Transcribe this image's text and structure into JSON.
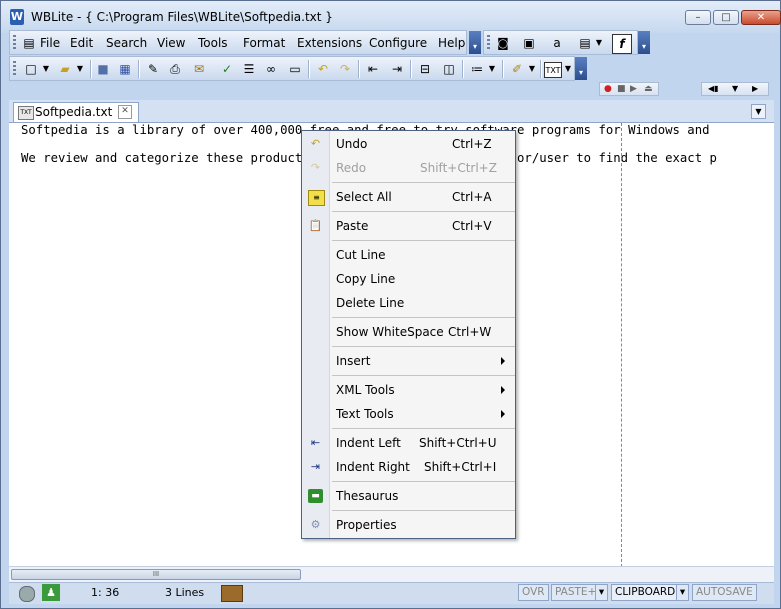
{
  "window": {
    "app_name": "WBLite",
    "title": "WBLite - { C:\\Program Files\\WBLite\\Softpedia.txt }",
    "controls": {
      "minimize": "–",
      "maximize": "□",
      "close": "✕"
    }
  },
  "menubar": {
    "items": [
      "File",
      "Edit",
      "Search",
      "View",
      "Tools",
      "Format",
      "Extensions",
      "Configure",
      "Help"
    ]
  },
  "toolbar_icons": {
    "row1": [
      "camera-icon",
      "box-icon",
      "font-icon",
      "page-icon",
      "function-icon"
    ],
    "row2": [
      "new-file-icon",
      "open-folder-icon",
      "save-icon",
      "save-all-icon",
      "brush-icon",
      "print-icon",
      "mail-icon",
      "spellcheck-icon",
      "list-icon",
      "link-icon",
      "field-icon",
      "undo-icon",
      "redo-icon",
      "indent-left-icon",
      "indent-right-icon",
      "split-horizontal-icon",
      "split-vertical-icon",
      "bullets-icon",
      "highlighter-icon",
      "txt-format-icon"
    ]
  },
  "tabs": [
    {
      "label": "Softpedia.txt",
      "icon": "txt-file-icon",
      "icon_text": "TXT"
    }
  ],
  "editor": {
    "lines": [
      "Softpedia is a library of over 400,000 free and free-to-try software programs for Windows and",
      "We review and categorize these products in order to allow the visitor/user to find the exact p"
    ]
  },
  "context_menu": {
    "items": [
      {
        "label": "Undo",
        "shortcut": "Ctrl+Z",
        "icon": "undo-icon",
        "enabled": true
      },
      {
        "label": "Redo",
        "shortcut": "Shift+Ctrl+Z",
        "icon": "redo-icon",
        "enabled": false
      },
      {
        "label": "Select All",
        "shortcut": "Ctrl+A",
        "icon": "select-all-icon",
        "enabled": true
      },
      {
        "label": "Paste",
        "shortcut": "Ctrl+V",
        "icon": "paste-icon",
        "enabled": true
      },
      {
        "label": "Cut Line",
        "shortcut": "",
        "enabled": true
      },
      {
        "label": "Copy Line",
        "shortcut": "",
        "enabled": true
      },
      {
        "label": "Delete Line",
        "shortcut": "",
        "enabled": true
      },
      {
        "label": "Show WhiteSpace",
        "shortcut": "Ctrl+W",
        "enabled": true
      },
      {
        "label": "Insert",
        "submenu": true,
        "enabled": true
      },
      {
        "label": "XML Tools",
        "submenu": true,
        "enabled": true
      },
      {
        "label": "Text Tools",
        "submenu": true,
        "enabled": true
      },
      {
        "label": "Indent Left",
        "shortcut": "Shift+Ctrl+U",
        "icon": "indent-left-icon",
        "enabled": true
      },
      {
        "label": "Indent Right",
        "shortcut": "Shift+Ctrl+I",
        "icon": "indent-right-icon",
        "enabled": true
      },
      {
        "label": "Thesaurus",
        "shortcut": "",
        "icon": "book-icon",
        "enabled": true
      },
      {
        "label": "Properties",
        "shortcut": "",
        "icon": "gears-icon",
        "enabled": true
      }
    ]
  },
  "scrollbar": {
    "thumb_grip": "III"
  },
  "status": {
    "position": "1: 36",
    "lines": "3 Lines",
    "ovr": "OVR",
    "paste_mode": "PASTE+",
    "clipboard": "CLIPBOARD",
    "autosave": "AUTOSAVE"
  },
  "colors": {
    "accent": "#2c4e8e",
    "chrome": "#c2d5ee"
  }
}
